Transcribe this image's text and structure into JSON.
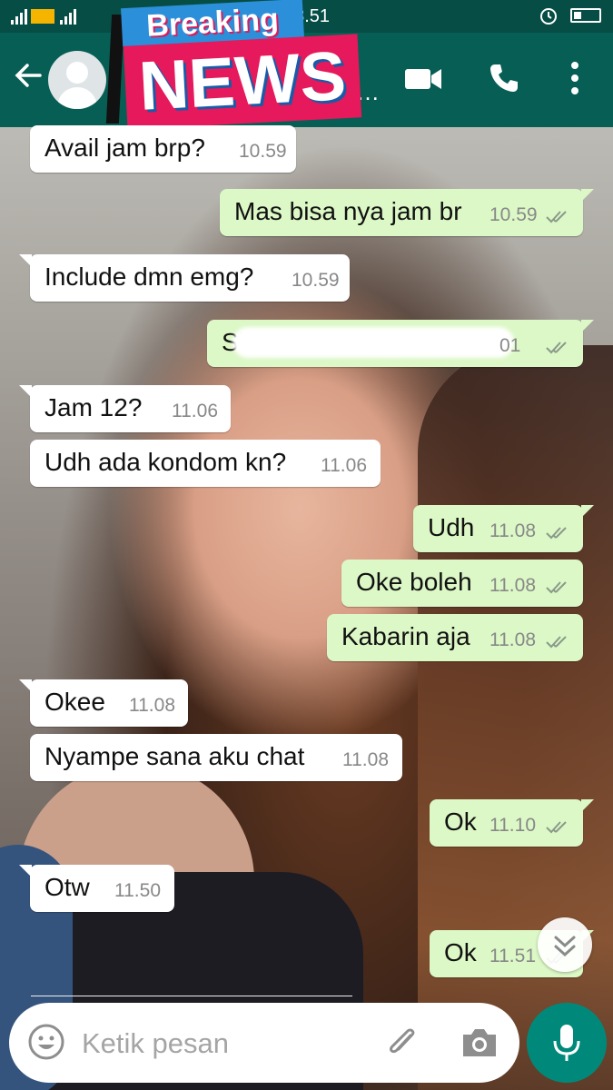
{
  "status_bar": {
    "time": "13.51"
  },
  "overlay": {
    "line1": "Breaking",
    "line2": "NEWS"
  },
  "chat": {
    "messages": [
      {
        "dir": "in",
        "text": "Avail jam brp?",
        "time": "10.59"
      },
      {
        "dir": "out",
        "text": "Mas bisa nya jam br",
        "time": "10.59"
      },
      {
        "dir": "in",
        "text": "Include dmn emg?",
        "time": "10.59"
      },
      {
        "dir": "out",
        "text": "Si",
        "time": "01"
      },
      {
        "dir": "in",
        "text": "Jam 12?",
        "time": "11.06"
      },
      {
        "dir": "in",
        "text": "Udh ada kondom kn?",
        "time": "11.06"
      },
      {
        "dir": "out",
        "text": "Udh",
        "time": "11.08"
      },
      {
        "dir": "out",
        "text": "Oke boleh",
        "time": "11.08"
      },
      {
        "dir": "out",
        "text": "Kabarin aja",
        "time": "11.08"
      },
      {
        "dir": "in",
        "text": "Okee",
        "time": "11.08"
      },
      {
        "dir": "in",
        "text": "Nyampe sana aku chat",
        "time": "11.08"
      },
      {
        "dir": "out",
        "text": "Ok",
        "time": "11.10"
      },
      {
        "dir": "in",
        "text": "Otw",
        "time": "11.50"
      },
      {
        "dir": "out",
        "text": "Ok",
        "time": "11.51"
      }
    ]
  },
  "composer": {
    "placeholder": "Ketik pesan"
  },
  "icons": {
    "back": "arrow-left-icon",
    "avatar": "default-avatar-icon",
    "video": "video-call-icon",
    "call": "phone-icon",
    "more": "more-vert-icon",
    "emoji": "emoji-icon",
    "attach": "paperclip-icon",
    "camera": "camera-icon",
    "mic": "microphone-icon",
    "scroll": "double-chevron-down-icon",
    "read": "double-check-icon"
  },
  "colors": {
    "header": "#075e54",
    "status_bar": "#064e45",
    "outgoing": "#dcf8c6",
    "incoming": "#ffffff",
    "mic": "#00897b"
  }
}
